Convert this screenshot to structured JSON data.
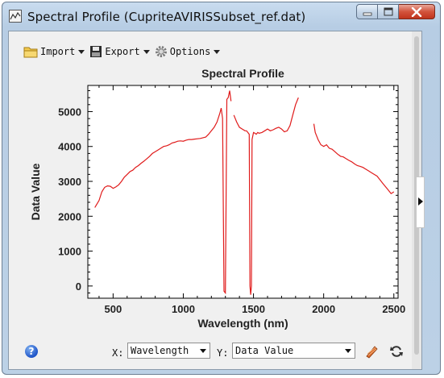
{
  "window": {
    "title": "Spectral Profile (CupriteAVIRISSubset_ref.dat)"
  },
  "toolbar": {
    "import_label": "Import",
    "export_label": "Export",
    "options_label": "Options"
  },
  "chart_data": {
    "type": "line",
    "title": "Spectral Profile",
    "xlabel": "Wavelength (nm)",
    "ylabel": "Data Value",
    "xlim": [
      320,
      2530
    ],
    "ylim": [
      -350,
      5750
    ],
    "xticks": [
      500,
      1000,
      1500,
      2000,
      2500
    ],
    "yticks": [
      0,
      1000,
      2000,
      3000,
      4000,
      5000
    ],
    "grid": false,
    "legend": "none",
    "line_color": "#e01b1b",
    "segments": [
      {
        "x": [
          370,
          380,
          400,
          420,
          440,
          460,
          480,
          500,
          520,
          540,
          560,
          580,
          600,
          620,
          640,
          660,
          680,
          700,
          720,
          740,
          760,
          780,
          800,
          820,
          840,
          860,
          880,
          900,
          920,
          940,
          960,
          980,
          1000,
          1020,
          1040,
          1060,
          1080,
          1100,
          1120,
          1140,
          1160,
          1180,
          1200,
          1220,
          1240,
          1260,
          1270,
          1280,
          1290,
          1300,
          1310,
          1320,
          1330,
          1340
        ],
        "y": [
          2250,
          2320,
          2450,
          2700,
          2830,
          2870,
          2860,
          2800,
          2840,
          2900,
          3000,
          3120,
          3200,
          3280,
          3320,
          3400,
          3450,
          3520,
          3580,
          3650,
          3720,
          3800,
          3850,
          3900,
          3950,
          4000,
          4020,
          4050,
          4100,
          4120,
          4150,
          4160,
          4150,
          4180,
          4200,
          4200,
          4210,
          4220,
          4230,
          4250,
          4270,
          4350,
          4450,
          4550,
          4700,
          4950,
          5100,
          4800,
          -150,
          -200,
          5350,
          5400,
          5600,
          5300
        ]
      },
      {
        "x": [
          1360,
          1380,
          1400,
          1420,
          1440,
          1450,
          1460,
          1470,
          1475,
          1480,
          1485,
          1490,
          1500,
          1510,
          1520,
          1530,
          1540,
          1560,
          1580,
          1600,
          1620,
          1640,
          1660,
          1680,
          1700,
          1720,
          1740,
          1760,
          1780,
          1800,
          1820
        ],
        "y": [
          4900,
          4700,
          4550,
          4500,
          4450,
          4450,
          4400,
          4350,
          0,
          -250,
          0,
          4200,
          4400,
          4380,
          4350,
          4400,
          4380,
          4400,
          4450,
          4500,
          4450,
          4480,
          4520,
          4550,
          4500,
          4420,
          4450,
          4600,
          4900,
          5200,
          5400
        ]
      },
      {
        "x": [
          1930,
          1940,
          1950,
          1960,
          1980,
          2000,
          2020,
          2040,
          2060,
          2080,
          2100,
          2120,
          2140,
          2160,
          2180,
          2200,
          2220,
          2240,
          2260,
          2280,
          2300,
          2320,
          2340,
          2360,
          2380,
          2400,
          2420,
          2440,
          2460,
          2480,
          2500
        ],
        "y": [
          4650,
          4400,
          4300,
          4200,
          4050,
          4000,
          4050,
          3950,
          3920,
          3850,
          3780,
          3720,
          3700,
          3650,
          3600,
          3560,
          3500,
          3450,
          3430,
          3400,
          3350,
          3300,
          3250,
          3200,
          3150,
          3050,
          2950,
          2850,
          2750,
          2650,
          2700
        ]
      }
    ]
  },
  "bottom": {
    "help_glyph": "?",
    "x_label": "X:",
    "x_value": "Wavelength",
    "y_label": "Y:",
    "y_value": "Data Value"
  },
  "icons": {
    "app": "spectral-profile-icon",
    "import": "folder-icon",
    "export": "floppy-disk-icon",
    "options": "gear-icon",
    "help": "help-icon",
    "pencil": "pencil-icon",
    "refresh": "refresh-icon"
  }
}
